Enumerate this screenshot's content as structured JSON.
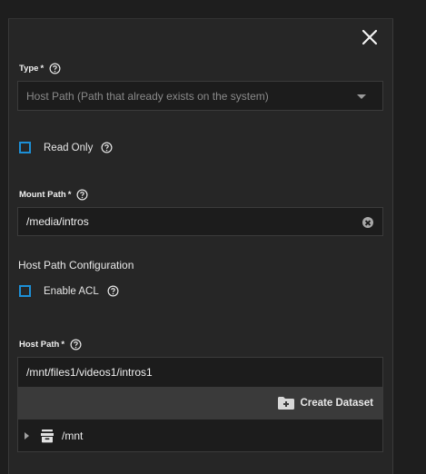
{
  "type_field": {
    "label": "Type",
    "required_mark": "*",
    "value": "Host Path (Path that already exists on the system)"
  },
  "read_only": {
    "label": "Read Only",
    "checked": false
  },
  "mount_path": {
    "label": "Mount Path",
    "required_mark": "*",
    "value": "/media/intros"
  },
  "host_path_config": {
    "title": "Host Path Configuration",
    "enable_acl": {
      "label": "Enable ACL",
      "checked": false
    }
  },
  "host_path": {
    "label": "Host Path",
    "required_mark": "*",
    "value": "/mnt/files1/videos1/intros1",
    "create_dataset_label": "Create Dataset",
    "tree": [
      {
        "name": "/mnt",
        "icon": "dataset-icon",
        "expanded": false
      }
    ]
  },
  "colors": {
    "accent": "#1d8fd6",
    "panel_bg": "#262626",
    "input_bg": "#1c1c1c"
  },
  "icons": {
    "close": "close-icon",
    "help": "help-circle-icon",
    "dropdown": "caret-down-icon",
    "clear": "clear-circle-icon",
    "create_dataset": "folder-plus-icon",
    "tree_expand": "chevron-right-icon",
    "dataset": "dataset-icon"
  }
}
